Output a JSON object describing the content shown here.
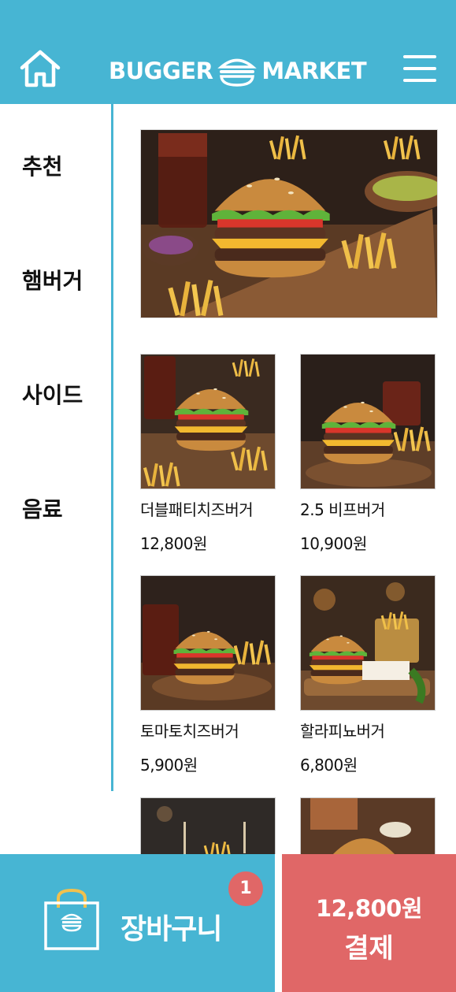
{
  "header": {
    "logo_left": "BUGGER",
    "logo_right": "MARKET",
    "home_icon": "home-icon",
    "menu_icon": "hamburger-menu-icon",
    "bg_color": "#47b5d3"
  },
  "categories": [
    "추천",
    "햄버거",
    "사이드",
    "음료"
  ],
  "products": [
    {
      "name": "더블패티치즈버거",
      "price": "12,800원"
    },
    {
      "name": "2.5 비프버거",
      "price": "10,900원"
    },
    {
      "name": "토마토치즈버거",
      "price": "5,900원"
    },
    {
      "name": "할라피뇨버거",
      "price": "6,800원"
    }
  ],
  "footer": {
    "cart_label": "장바구니",
    "cart_count": "1",
    "pay_total": "12,800원",
    "pay_label": "결제",
    "cart_color": "#47b5d3",
    "pay_color": "#e06767",
    "bag_icon": "shopping-bag-icon"
  }
}
